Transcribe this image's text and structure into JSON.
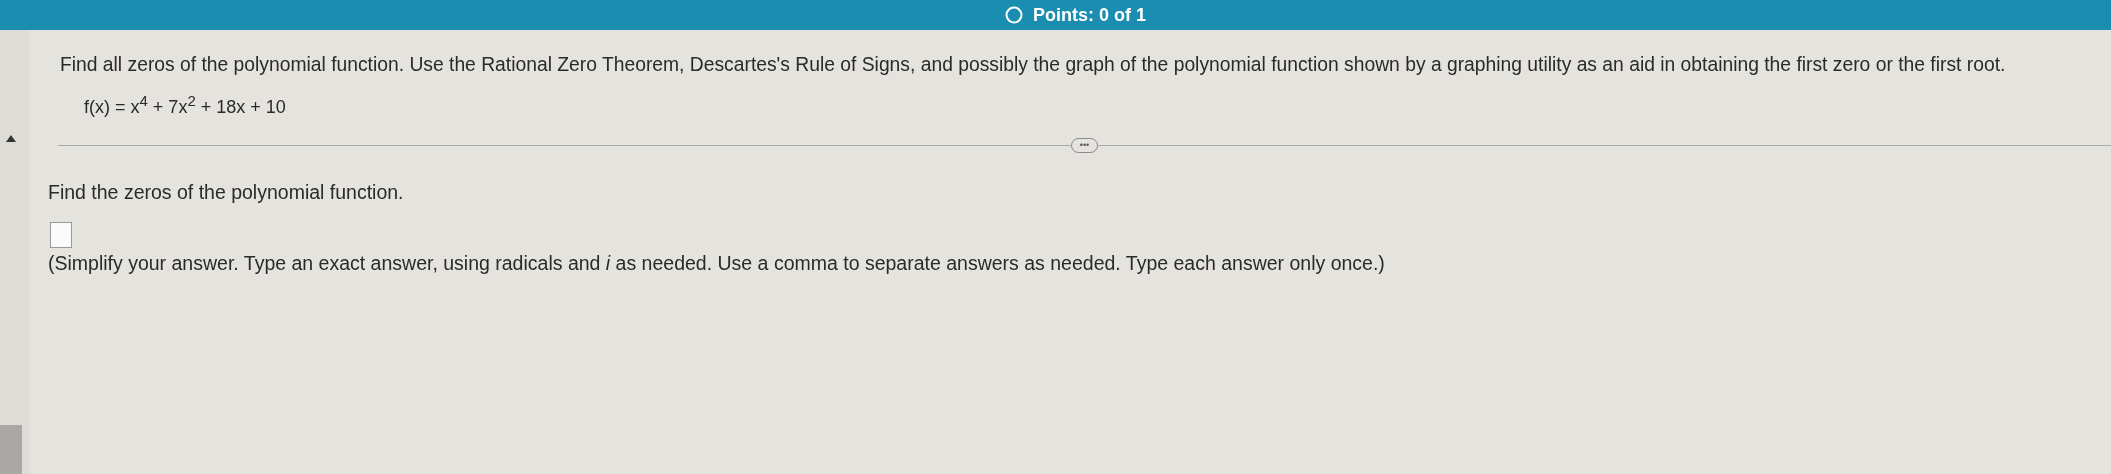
{
  "header": {
    "points": "Points: 0 of 1"
  },
  "question": {
    "instruction": "Find all zeros of the polynomial function. Use the Rational Zero Theorem, Descartes's Rule of Signs, and possibly the graph of the polynomial function shown by a graphing utility as an aid in obtaining the first zero or the first root.",
    "function": "f(x) = x$^{4}$ + 7x$^{2}$ + 18x + 10"
  },
  "expand_button": "•••",
  "task": {
    "prompt": "Find the zeros of the polynomial function.",
    "hint": "(Simplify your answer. Type an exact answer, using radicals and *i* as needed. Use a comma to separate answers as needed. Type each answer only once.)"
  }
}
